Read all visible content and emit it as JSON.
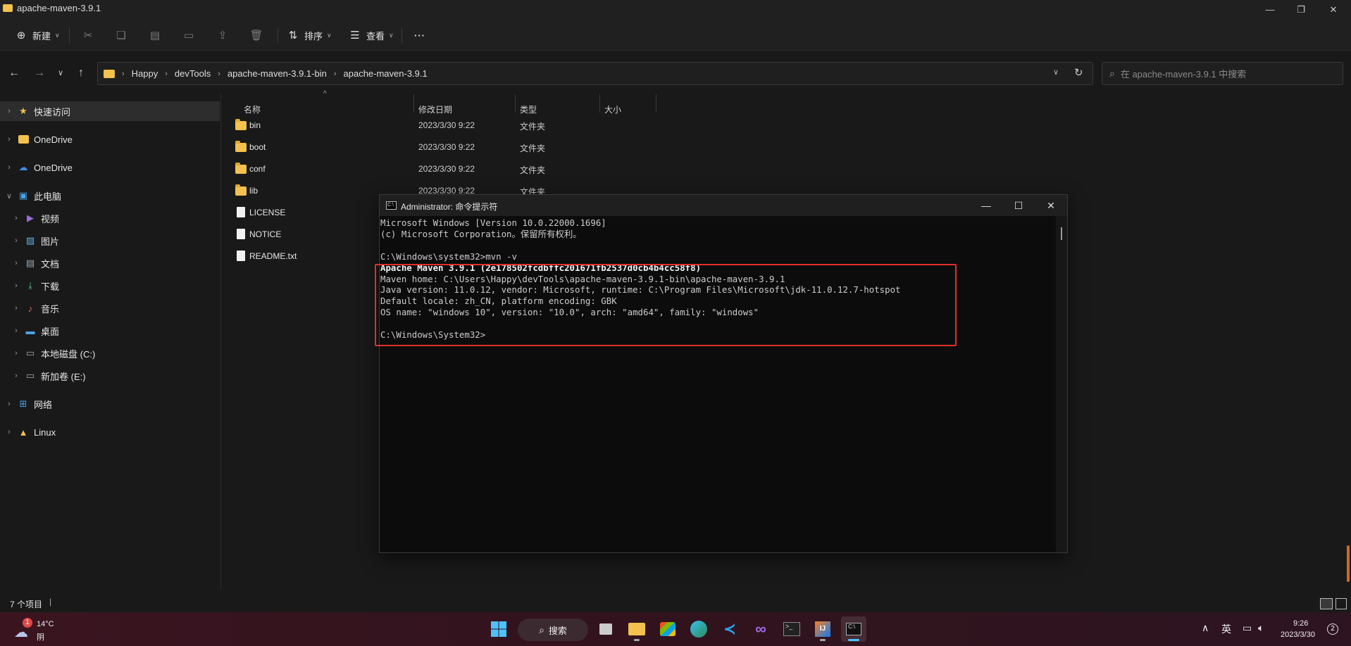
{
  "window": {
    "title": "apache-maven-3.9.1"
  },
  "commandbar": {
    "new_label": "新建",
    "sort_label": "排序",
    "view_label": "查看",
    "more_label": "···"
  },
  "address": {
    "crumbs": [
      "Happy",
      "devTools",
      "apache-maven-3.9.1-bin",
      "apache-maven-3.9.1"
    ],
    "search_placeholder": "在 apache-maven-3.9.1 中搜索"
  },
  "sidebar": {
    "items": [
      {
        "label": "快速访问",
        "icon": "star-icon"
      },
      {
        "label": "OneDrive",
        "icon": "folder-icon"
      },
      {
        "label": "OneDrive",
        "icon": "cloud-icon"
      },
      {
        "label": "此电脑",
        "icon": "computer-icon"
      },
      {
        "label": "视频",
        "icon": "video-icon"
      },
      {
        "label": "图片",
        "icon": "picture-icon"
      },
      {
        "label": "文档",
        "icon": "document-icon"
      },
      {
        "label": "下载",
        "icon": "download-icon"
      },
      {
        "label": "音乐",
        "icon": "music-icon"
      },
      {
        "label": "桌面",
        "icon": "desktop-icon"
      },
      {
        "label": "本地磁盘 (C:)",
        "icon": "drive-icon"
      },
      {
        "label": "新加卷 (E:)",
        "icon": "drive-icon"
      },
      {
        "label": "网络",
        "icon": "network-icon"
      },
      {
        "label": "Linux",
        "icon": "linux-icon"
      }
    ]
  },
  "filelist": {
    "headers": {
      "name": "名称",
      "date": "修改日期",
      "type": "类型",
      "size": "大小"
    },
    "rows": [
      {
        "name": "bin",
        "date": "2023/3/30 9:22",
        "type": "文件夹",
        "kind": "folder"
      },
      {
        "name": "boot",
        "date": "2023/3/30 9:22",
        "type": "文件夹",
        "kind": "folder"
      },
      {
        "name": "conf",
        "date": "2023/3/30 9:22",
        "type": "文件夹",
        "kind": "folder"
      },
      {
        "name": "lib",
        "date": "2023/3/30 9:22",
        "type": "文件夹",
        "kind": "folder"
      },
      {
        "name": "LICENSE",
        "date": "",
        "type": "",
        "kind": "file"
      },
      {
        "name": "NOTICE",
        "date": "",
        "type": "",
        "kind": "file"
      },
      {
        "name": "README.txt",
        "date": "",
        "type": "",
        "kind": "file"
      }
    ]
  },
  "status": {
    "item_count": "7 个项目"
  },
  "cmd": {
    "title": "Administrator: 命令提示符",
    "lines": [
      "Microsoft Windows [Version 10.0.22000.1696]",
      "(c) Microsoft Corporation。保留所有权利。",
      "",
      "C:\\Windows\\system32>mvn -v",
      "Apache Maven 3.9.1 (2e178502fcdbffc201671fb2537d0cb4b4cc58f8)",
      "Maven home: C:\\Users\\Happy\\devTools\\apache-maven-3.9.1-bin\\apache-maven-3.9.1",
      "Java version: 11.0.12, vendor: Microsoft, runtime: C:\\Program Files\\Microsoft\\jdk-11.0.12.7-hotspot",
      "Default locale: zh_CN, platform encoding: GBK",
      "OS name: \"windows 10\", version: \"10.0\", arch: \"amd64\", family: \"windows\"",
      "",
      "C:\\Windows\\System32>"
    ]
  },
  "taskbar": {
    "weather_temp": "14°C",
    "weather_desc": "阴",
    "weather_badge": "1",
    "search_label": "搜索",
    "ime": "英",
    "time": "9:26",
    "date": "2023/3/30",
    "notification_count": "2"
  },
  "colors": {
    "accent": "#e0302a",
    "folder": "#f2c14e"
  }
}
